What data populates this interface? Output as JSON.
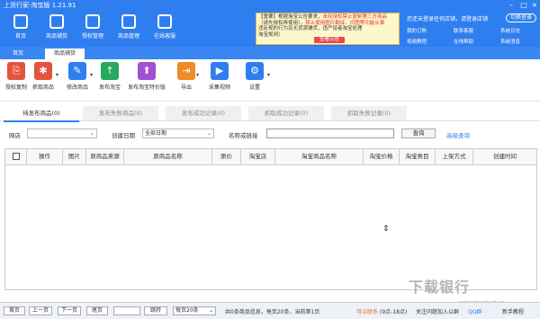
{
  "window": {
    "title": "上货行家-淘宝版 1.21.91"
  },
  "topnav": [
    {
      "label": "首页",
      "icon": "home-icon"
    },
    {
      "label": "商品铺货",
      "icon": "goods-icon"
    },
    {
      "label": "授权管理",
      "icon": "auth-icon"
    },
    {
      "label": "商品管理",
      "icon": "manage-icon"
    },
    {
      "label": "在线客服",
      "icon": "service-icon"
    }
  ],
  "notice": {
    "line1": "【重要】根据淘宝公告要求，",
    "line1_red": "未经授权禁止复制第三方商品",
    "line2": "（请先授权再使用），",
    "line2_red": "禁止使用图片翻译，切图等功能从事",
    "line3": "违反规的行为及无货源铺货，违严惩者淘宝处理",
    "line4": "淘宝规则）",
    "button": "查看公告"
  },
  "account": {
    "login_prompt": "您还未登录任何店铺，请登录店铺",
    "login_button": "切换登录",
    "links": [
      "我的订购",
      "联系客服",
      "系统日志",
      "视频教程",
      "在线帮助",
      "系统消息"
    ]
  },
  "tabs": [
    "首页",
    "商品铺货"
  ],
  "toolbar": [
    {
      "label": "授权复制",
      "icon": "auth-copy-icon",
      "color": "#e6533c"
    },
    {
      "label": "抓取商品",
      "icon": "grab-icon",
      "color": "#e6533c"
    },
    {
      "label": "修改商品",
      "icon": "edit-icon",
      "color": "#2f7ef0"
    },
    {
      "label": "发布淘宝",
      "icon": "publish-icon",
      "color": "#27a860"
    },
    {
      "label": "发布淘宝特价版",
      "icon": "publish-special-icon",
      "color": "#a050d0"
    },
    {
      "label": "导出",
      "icon": "export-icon",
      "color": "#f08a24"
    },
    {
      "label": "采集视频",
      "icon": "video-icon",
      "color": "#2f7ef0"
    },
    {
      "label": "设置",
      "icon": "gear-icon",
      "color": "#2f7ef0"
    }
  ],
  "subtabs": [
    "待发布商品(0)",
    "发布失败商品(0)",
    "发布成功记录(0)",
    "抓取成功记录(0)",
    "抓取失败记录(0)"
  ],
  "filter": {
    "source_label": "网店",
    "source_value": "",
    "date_label": "创建日期",
    "date_value": "全部日期",
    "name_label": "名称或链接",
    "name_value": "",
    "query_button": "查询",
    "advanced_link": "高级查询"
  },
  "table": {
    "columns": [
      "",
      "操作",
      "图片",
      "原商品来源",
      "原商品名称",
      "原价",
      "淘宝店",
      "淘宝商品名称",
      "淘宝价格",
      "淘宝类目",
      "上架方式",
      "创建时间"
    ],
    "rows": []
  },
  "pager": {
    "first": "首页",
    "prev": "上一页",
    "next": "下一页",
    "last": "尾页",
    "jump": "跳转",
    "per_page": "每页20条",
    "summary": "共0条商品信息，每页20条，当前第1页",
    "contact": "可以联系",
    "hours": "(9点-18点)",
    "status": "关注问题加入以群",
    "phone": "",
    "newbie": "新手教程",
    "qq": "QQ群"
  },
  "watermark": {
    "text": "下载银行",
    "url": "www.downbank.cn"
  }
}
